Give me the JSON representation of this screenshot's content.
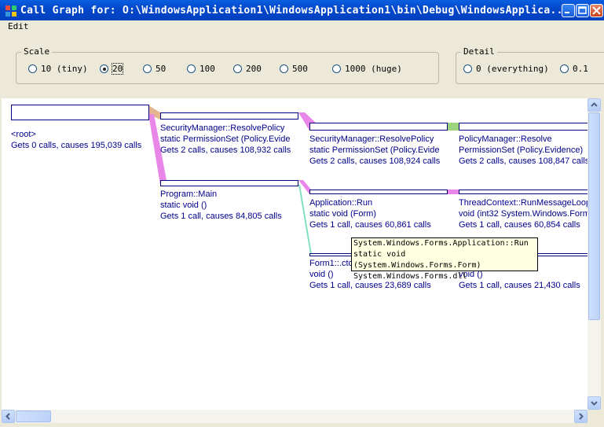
{
  "window": {
    "title": "Call Graph for: O:\\WindowsApplication1\\WindowsApplication1\\bin\\Debug\\WindowsApplica...",
    "minimize_icon": "minimize-icon",
    "maximize_icon": "maximize-icon",
    "close_icon": "close-icon"
  },
  "menu": {
    "edit": "Edit"
  },
  "scale": {
    "label": "Scale",
    "options": [
      "10 (tiny)",
      "20",
      "50",
      "100",
      "200",
      "500",
      "1000 (huge)"
    ],
    "selected": "20"
  },
  "detail": {
    "label": "Detail",
    "options": [
      "0 (everything)",
      "0.1"
    ],
    "selected": ""
  },
  "graph": {
    "root": {
      "name": "<root>",
      "stats": "Gets 0 calls, causes 195,039 calls"
    },
    "sec1": {
      "name": "SecurityManager::ResolvePolicy",
      "sig": "static  PermissionSet (Policy.Evide",
      "stats": "Gets 2 calls, causes 108,932 calls"
    },
    "sec2": {
      "name": "SecurityManager::ResolvePolicy",
      "sig": "static  PermissionSet (Policy.Evide",
      "stats": "Gets 2 calls, causes 108,924 calls"
    },
    "policy": {
      "name": "PolicyManager::Resolve",
      "sig": "PermissionSet (Policy.Evidence)",
      "stats": "Gets 2 calls, causes 108,847 calls"
    },
    "main": {
      "name": "Program::Main",
      "sig": "static void ()",
      "stats": "Gets 1 call, causes 84,805 calls"
    },
    "apprun": {
      "name": "Application::Run",
      "sig": "static void (Form)",
      "stats": "Gets 1 call, causes 60,861 calls"
    },
    "thread": {
      "name": "ThreadContext::RunMessageLoop",
      "sig": "void  (int32 System.Windows.Form",
      "stats": "Gets 1 call, causes 60,854 calls"
    },
    "form1": {
      "name": "Form1::.ctor",
      "sig": "void ()",
      "stats": "Gets 1 call, causes 23,689 calls"
    },
    "form1child": {
      "sig": "void ()",
      "stats": "Gets 1 call, causes 21,430 calls"
    }
  },
  "tooltip": {
    "line1": "System.Windows.Forms.Application::Run",
    "line2": "static void (System.Windows.Forms.Form)",
    "line3": "System.Windows.Forms.dll"
  },
  "colors": {
    "link_pink": "#e987e9",
    "link_green": "#9fd47f",
    "link_teal": "#7fe0c0",
    "link_tan": "#e4b58f",
    "node_border": "#000080",
    "node_text": "#00008b"
  }
}
